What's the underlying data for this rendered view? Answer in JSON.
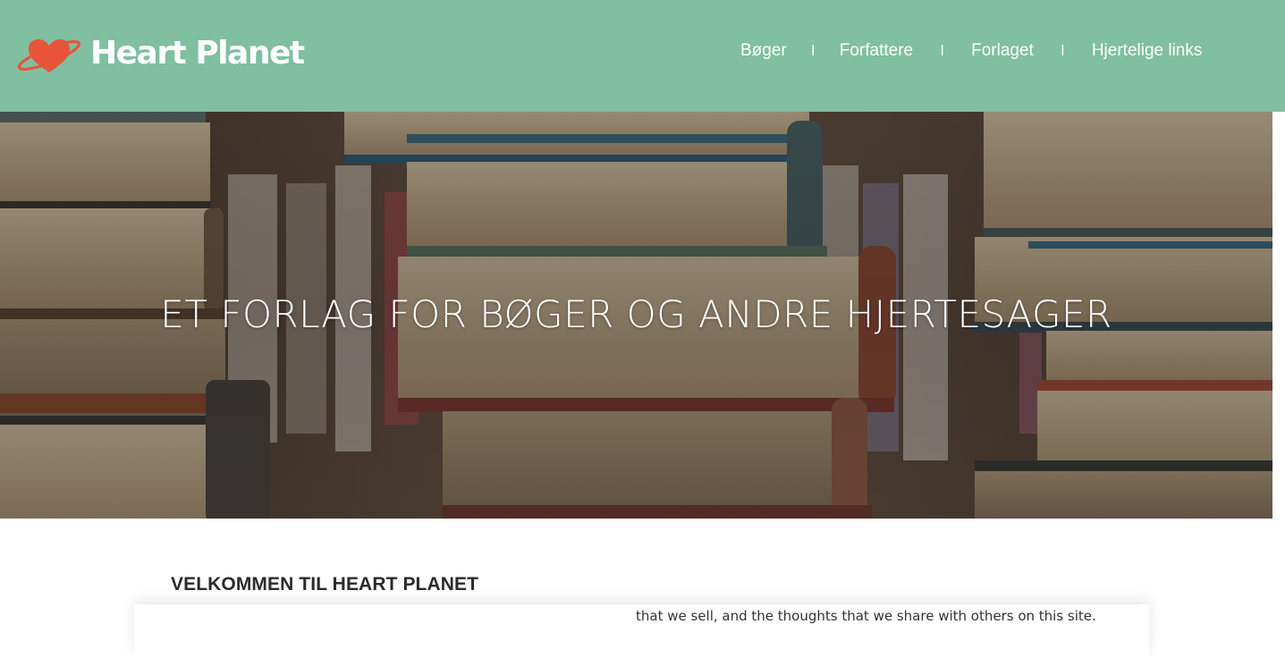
{
  "brand": {
    "name": "Heart Planet",
    "icon": "heart-planet-icon",
    "header_color": "#80bfa0",
    "logo_color": "#e8543a"
  },
  "nav": {
    "items": [
      {
        "label": "Bøger"
      },
      {
        "label": "Forfattere"
      },
      {
        "label": "Forlaget"
      },
      {
        "label": "Hjertelige links"
      }
    ],
    "separator": "l"
  },
  "hero": {
    "title": "ET FORLAG FOR BØGER OG ANDRE HJERTESAGER",
    "image": "stacked-books-photo"
  },
  "welcome": {
    "heading": "VELKOMMEN TIL HEART PLANET",
    "text": "that we sell, and the thoughts that we share with others on this site."
  }
}
